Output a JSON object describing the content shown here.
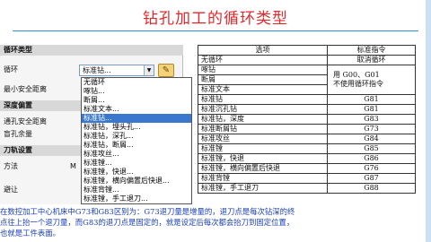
{
  "title": "钻孔加工的循环类型",
  "panel": {
    "sections": [
      "循环类型",
      "深度偏置",
      "刀轨设置"
    ],
    "cycle_label": "循环",
    "cycle_value": "标准钻...",
    "min_clearance_label": "最小安全距离",
    "through_clearance_label": "通孔安全距离",
    "blind_remainder_label": "盲孔余量",
    "method_label": "方法",
    "method_value": "M",
    "avoid_label": "避让"
  },
  "dropdown": {
    "items": [
      "无循环",
      "啄钻...",
      "断屑...",
      "标准文本...",
      "标准钻...",
      "标准钻，埋头孔...",
      "标准钻，深孔...",
      "标准钻，断屑...",
      "标准攻丝...",
      "标准镗...",
      "标准镗，快退...",
      "标准镗，横向偏置后快退...",
      "标准背镗...",
      "标准镗，手工退刀..."
    ],
    "selected_index": 4
  },
  "table": {
    "headers": [
      "选项",
      "标准指令"
    ],
    "rows": [
      [
        "无循环",
        "取消循环"
      ],
      [
        "啄钻",
        "用 G00、G01"
      ],
      [
        "断屑",
        "不使用循环指令"
      ],
      [
        "标准文本",
        ""
      ],
      [
        "标准钻",
        "G81"
      ],
      [
        "标准沉孔钻",
        "G81"
      ],
      [
        "标准钻，深度",
        "G83"
      ],
      [
        "标准断屑钻",
        "G73"
      ],
      [
        "标准攻丝",
        "G84"
      ],
      [
        "标准镗",
        "G85"
      ],
      [
        "标准镗，快退",
        "G86"
      ],
      [
        "标准镗，横向偏置后快退",
        "G76"
      ],
      [
        "标准背镗",
        "G87"
      ],
      [
        "标准镗，手工退刀",
        "G88"
      ]
    ]
  },
  "description": [
    "在数控加工中心机床中G73和G83区别为：G73退刀量是增量的，退刀点是每次钻深的终",
    "点往上抬一个退刀量，而G83的退刀点是固定的，就是设定后每次都会抬刀到固定位置，",
    "也就是工件表面。"
  ],
  "colors": {
    "title": "#e0292c",
    "selection": "#3a78d0",
    "description": "#1a3fb5"
  }
}
